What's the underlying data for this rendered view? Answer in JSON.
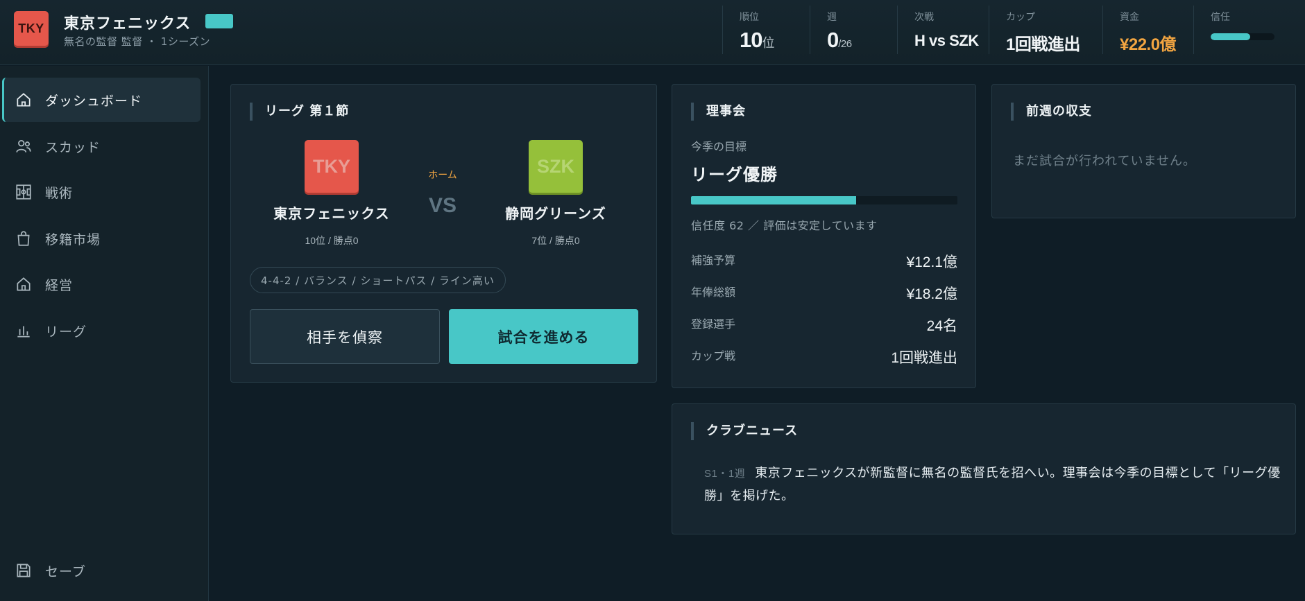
{
  "header": {
    "club_badge": "TKY",
    "club_name": "東京フェニックス",
    "club_tag": "",
    "club_sub": "無名の監督 監督 ・ 1シーズン",
    "stats": {
      "rank": {
        "label": "順位",
        "value": "10",
        "unit": "位"
      },
      "week": {
        "label": "週",
        "value": "0",
        "total": "/26"
      },
      "next": {
        "label": "次戦",
        "value": "H vs SZK"
      },
      "cup": {
        "label": "カップ",
        "value": "1回戦進出"
      },
      "funds": {
        "label": "資金",
        "value": "¥22.0億"
      },
      "trust": {
        "label": "信任",
        "fraction": 0.62
      }
    },
    "colors": {
      "accent": "#48c7c7",
      "gold": "#f2a541"
    }
  },
  "sidebar": {
    "items": [
      {
        "label": "ダッシュボード",
        "icon": "home-icon",
        "active": true
      },
      {
        "label": "スカッド",
        "icon": "users-icon",
        "active": false
      },
      {
        "label": "戦術",
        "icon": "tactics-board-icon",
        "active": false
      },
      {
        "label": "移籍市場",
        "icon": "shopping-bag-icon",
        "active": false
      },
      {
        "label": "経営",
        "icon": "building-icon",
        "active": false
      },
      {
        "label": "リーグ",
        "icon": "bar-chart-icon",
        "active": false
      }
    ],
    "save_label": "セーブ",
    "save_icon": "floppy-disk-icon"
  },
  "match": {
    "title": "リーグ 第１節",
    "home": {
      "badge": "TKY",
      "name": "東京フェニックス",
      "record": "10位 / 勝点0",
      "color": "#e5574b"
    },
    "away": {
      "badge": "SZK",
      "name": "静岡グリーンズ",
      "record": "7位 / 勝点0",
      "color": "#95c03a"
    },
    "home_label": "ホーム",
    "vs": "VS",
    "tactic": "4-4-2 / バランス / ショートパス / ライン高い",
    "scout_label": "相手を偵察",
    "play_label": "試合を進める"
  },
  "board": {
    "title": "理事会",
    "goal_label": "今季の目標",
    "goal_value": "リーグ優勝",
    "trust_fraction": 0.62,
    "trust_text": "信任度 62 ／ 評価は安定しています",
    "rows": [
      {
        "key": "補強予算",
        "value": "¥12.1億"
      },
      {
        "key": "年俸総額",
        "value": "¥18.2億"
      },
      {
        "key": "登録選手",
        "value": "24名"
      },
      {
        "key": "カップ戦",
        "value": "1回戦進出"
      }
    ]
  },
  "finance": {
    "title": "前週の収支",
    "empty_text": "まだ試合が行われていません。"
  },
  "news": {
    "title": "クラブニュース",
    "items": [
      {
        "date": "S1・1週",
        "text": "東京フェニックスが新監督に無名の監督氏を招へい。理事会は今季の目標として「リーグ優勝」を掲げた。"
      }
    ]
  }
}
